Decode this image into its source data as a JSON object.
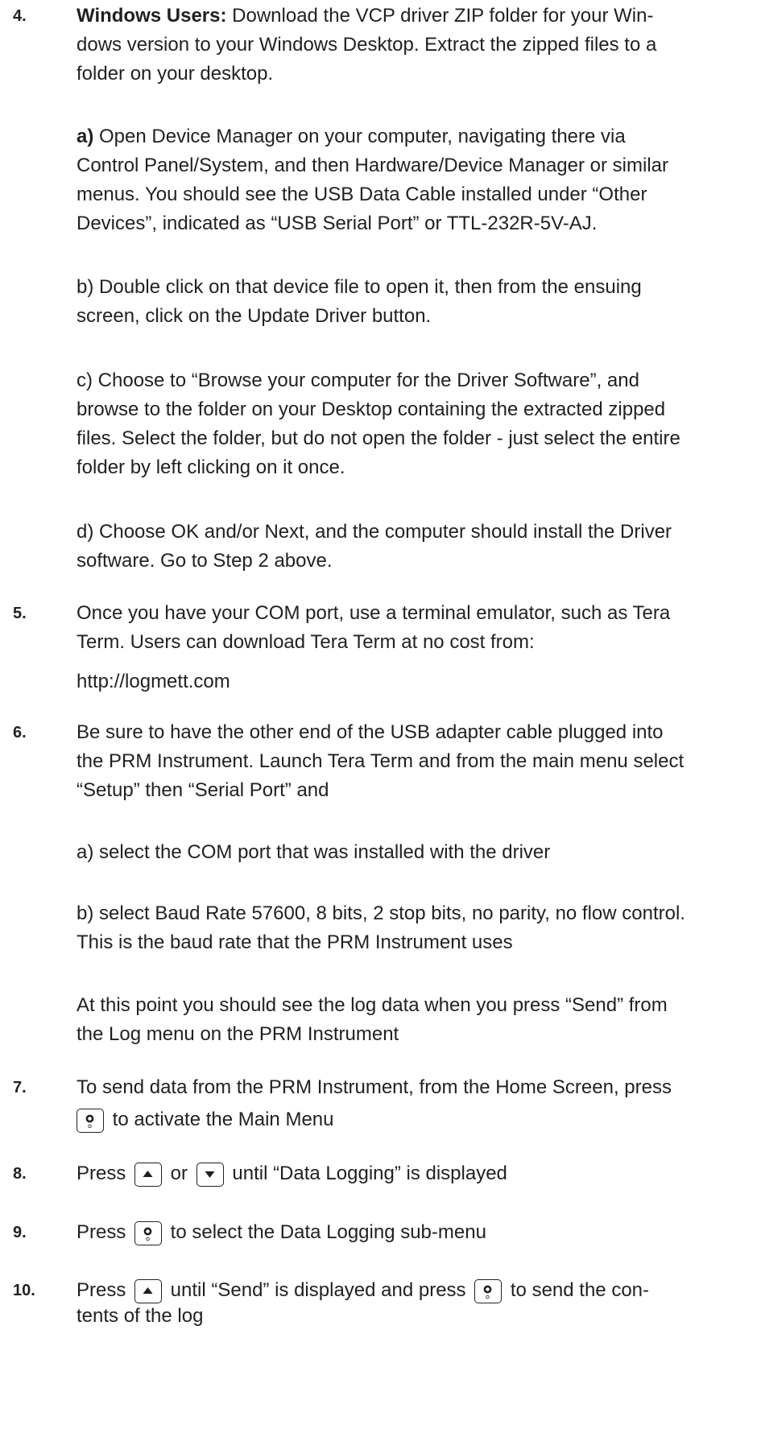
{
  "steps": {
    "s4": {
      "num": "4.",
      "lead": "Windows Users:",
      "line1": " Download the VCP driver ZIP folder for your Win-",
      "line2": "dows version to your Windows Desktop. Extract the zipped files to a",
      "line3": "folder on your desktop.",
      "a_lead": "a)",
      "a_line1": " Open Device Manager on your computer, navigating there via",
      "a_line2": "Control Panel/System, and then Hardware/Device Manager or similar",
      "a_line3": "menus.  You should see the USB Data Cable installed under “Other",
      "a_line4": "Devices”, indicated as “USB Serial Port” or TTL-232R-5V-AJ.",
      "b_line1": "b) Double click on that device file to open it, then from the ensuing",
      "b_line2": "screen, click on the Update Driver button.",
      "c_line1": "c) Choose to “Browse your computer for the Driver Software”, and",
      "c_line2": "browse to the folder on your Desktop containing the extracted zipped",
      "c_line3": "files. Select the folder, but do not open the folder - just select the entire",
      "c_line4": "folder by left clicking on it once.",
      "d_line1": "d) Choose OK and/or Next, and the computer should install the Driver",
      "d_line2": "software. Go to Step 2 above."
    },
    "s5": {
      "num": "5.",
      "line1": "Once you have your COM port, use a terminal emulator, such as Tera",
      "line2": "Term. Users can download Tera Term at no cost from:",
      "url": "http://logmett.com"
    },
    "s6": {
      "num": "6.",
      "line1": "Be sure to have the other end of the USB adapter cable plugged into",
      "line2": "the PRM Instrument. Launch Tera Term and from the main menu select",
      "line3": "“Setup” then “Serial Port” and",
      "a_line1": "a) select the COM port that was installed with the driver",
      "b_line1": "b) select Baud Rate 57600, 8 bits, 2 stop bits, no parity, no flow control.",
      "b_line2": "This is the baud rate that the PRM Instrument uses",
      "p_line1": "At this point you should see the log data when you press “Send” from",
      "p_line2": "the Log menu on the PRM Instrument"
    },
    "s7": {
      "num": "7.",
      "line1": "To send data from the PRM Instrument, from the Home Screen, press",
      "line2_after": " to activate the Main Menu"
    },
    "s8": {
      "num": "8.",
      "press": "Press ",
      "or": " or ",
      "after": " until “Data Logging” is displayed"
    },
    "s9": {
      "num": "9.",
      "press": "Press ",
      "after": " to select the Data Logging sub-menu"
    },
    "s10": {
      "num": "10.",
      "press": "Press ",
      "mid": " until “Send” is displayed and press ",
      "after": " to send the con-",
      "line2": "tents of the log"
    }
  },
  "icons": {
    "select": "select-button-icon",
    "up": "up-arrow-button-icon",
    "down": "down-arrow-button-icon"
  }
}
